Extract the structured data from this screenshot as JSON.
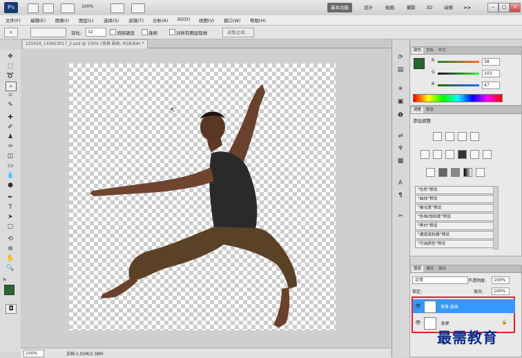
{
  "app": {
    "logo": "Ps",
    "zoom": "100%"
  },
  "workspace": {
    "active": "基本功能",
    "items": [
      "设计",
      "绘画",
      "摄影",
      "3D",
      "动感"
    ],
    "more": ">>"
  },
  "menu": [
    "文件(F)",
    "编辑(E)",
    "图像(I)",
    "图层(L)",
    "选择(S)",
    "滤镜(T)",
    "分析(A)",
    "3D(D)",
    "视图(V)",
    "窗口(W)",
    "帮助(H)"
  ],
  "options": {
    "feather_label": "羽化:",
    "feather_value": "32",
    "antialias": "消除锯齿",
    "contiguous": "连续",
    "sample_all": "对所有图层取样",
    "refine": "调整边缘..."
  },
  "document": {
    "tab_title": "225028_143623017_2.psd @ 100% (背景 副本, RGB/8#) *",
    "status_zoom": "100%",
    "status_doc": "文档:1.02M/2.38M"
  },
  "color_panel": {
    "tabs": [
      "颜色",
      "色板",
      "样式"
    ],
    "channels": [
      {
        "label": "R",
        "value": "38"
      },
      {
        "label": "G",
        "value": "103"
      },
      {
        "label": "B",
        "value": "47"
      }
    ],
    "fg": "#26672f"
  },
  "adjust_panel": {
    "tabs": [
      "调整",
      "蒙版"
    ],
    "title": "添加调整",
    "presets": [
      "\"色阶\"预设",
      "\"曲线\"预设",
      "\"曝光度\"预设",
      "\"色相/饱和度\"预设",
      "\"黑白\"预设",
      "\"通道混和器\"预设",
      "\"可选颜色\"预设"
    ]
  },
  "layers_panel": {
    "tabs": [
      "图层",
      "通道",
      "路径"
    ],
    "blend_mode": "正常",
    "opacity_label": "不透明度:",
    "opacity_value": "100%",
    "lock_label": "锁定:",
    "fill_label": "填充:",
    "fill_value": "100%",
    "layers": [
      {
        "name": "背景 副本",
        "selected": true
      },
      {
        "name": "背景",
        "selected": false
      }
    ]
  },
  "watermark": "最需教育",
  "colors": {
    "selection_blue": "#3399ff",
    "highlight_red": "#e02020"
  }
}
